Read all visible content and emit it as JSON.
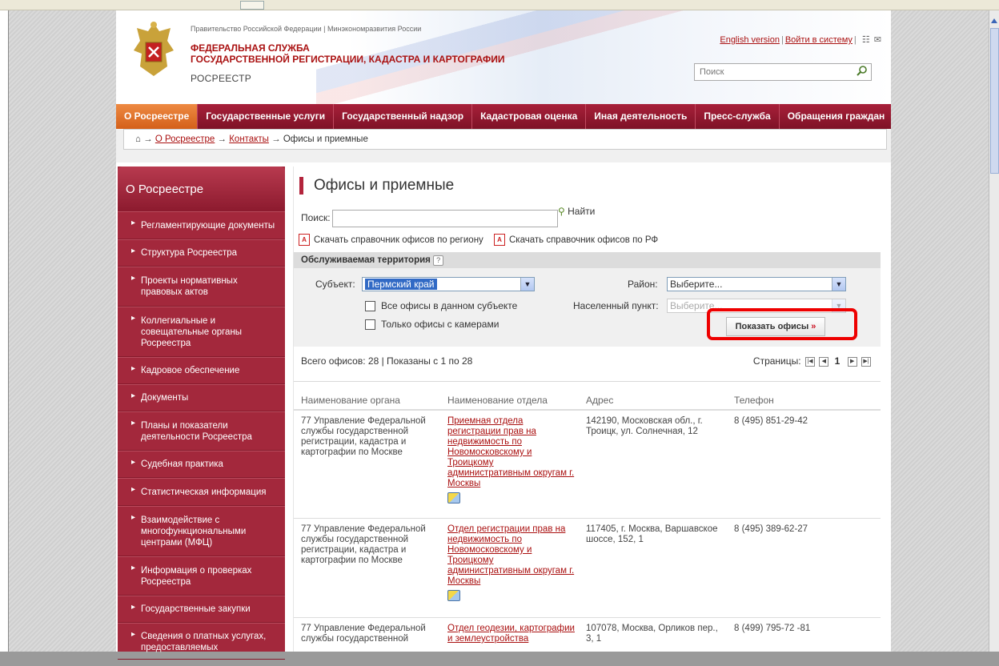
{
  "header": {
    "gov_line": "Правительство Российской Федерации | Минэкономразвития России",
    "service_name_1": "ФЕДЕРАЛЬНАЯ СЛУЖБА",
    "service_name_2": "ГОСУДАРСТВЕННОЙ РЕГИСТРАЦИИ, КАДАСТРА И КАРТОГРАФИИ",
    "short_name": "РОСРЕЕСТР",
    "english_link": "English version",
    "login_link": "Войти в систему",
    "search_placeholder": "Поиск",
    "icons": [
      "sitemap-icon",
      "mail-icon",
      "search-icon"
    ]
  },
  "nav": {
    "items": [
      {
        "label": "О Росреестре",
        "active": true
      },
      {
        "label": "Государственные услуги"
      },
      {
        "label": "Государственный надзор"
      },
      {
        "label": "Кадастровая оценка"
      },
      {
        "label": "Иная деятельность"
      },
      {
        "label": "Пресс-служба"
      },
      {
        "label": "Обращения граждан"
      }
    ]
  },
  "breadcrumb": {
    "home_icon": "home-icon",
    "sep": "→",
    "items": [
      "О Росреестре",
      "Контакты"
    ],
    "current": "Офисы и приемные"
  },
  "sidebar": {
    "title": "О Росреестре",
    "items": [
      "Регламентирующие документы",
      "Структура Росреестра",
      "Проекты нормативных правовых актов",
      "Коллегиальные и совещательные органы Росреестра",
      "Кадровое обеспечение",
      "Документы",
      "Планы и показатели деятельности Росреестра",
      "Судебная практика",
      "Статистическая информация",
      "Взаимодействие с многофункциональными центрами (МФЦ)",
      "Информация о проверках Росреестра",
      "Государственные закупки",
      "Сведения о платных услугах, предоставляемых"
    ]
  },
  "main": {
    "title": "Офисы и приемные",
    "search_label": "Поиск:",
    "search_value": "",
    "find_label": "Найти",
    "download_region": "Скачать справочник офисов по региону",
    "download_rf": "Скачать справочник офисов по РФ",
    "filter": {
      "header": "Обслуживаемая территория",
      "help": "?",
      "subject_label": "Субъект:",
      "subject_value": "Пермский край",
      "district_label": "Район:",
      "district_value": "Выберите...",
      "locality_label": "Населенный пункт:",
      "locality_value": "Выберите...",
      "all_offices_label": "Все офисы в данном субъекте",
      "camera_offices_label": "Только офисы с камерами",
      "show_button": "Показать офисы",
      "show_button_arrows": "»"
    },
    "summary": "Всего офисов: 28 | Показаны с 1 по 28",
    "pager": {
      "label": "Страницы:",
      "current": "1"
    },
    "table": {
      "headers": [
        "Наименование органа",
        "Наименование отдела",
        "Адрес",
        "Телефон"
      ],
      "rows": [
        {
          "org": "77 Управление Федеральной службы государственной регистрации, кадастра и картографии по Москве",
          "dept": "Приемная отдела регистрации прав на недвижимость по Новомосковскому и Троицкому административным округам г. Москвы",
          "address": "142190, Московская обл., г. Троицк, ул. Солнечная, 12",
          "phone": "8 (495) 851-29-42"
        },
        {
          "org": "77 Управление Федеральной службы государственной регистрации, кадастра и картографии по Москве",
          "dept": "Отдел регистрации прав на недвижимость по Новомосковскому и Троицкому административным округам г. Москвы",
          "address": "117405, г. Москва, Варшавское шоссе, 152, 1",
          "phone": "8 (495) 389-62-27"
        },
        {
          "org": "77 Управление Федеральной службы государственной",
          "dept": "Отдел геодезии, картографии и землеустройства",
          "address": "107078, Москва, Орликов пер., 3, 1",
          "phone": "8 (499) 795-72 -81"
        }
      ]
    }
  }
}
